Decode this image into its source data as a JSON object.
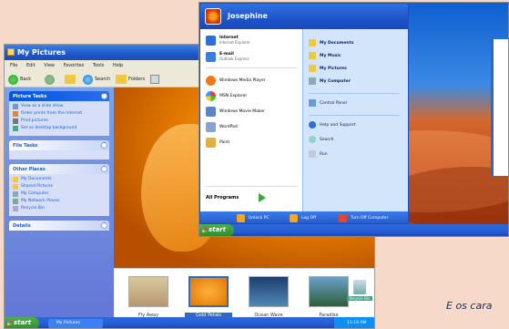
{
  "my_pictures": {
    "title": "My Pictures",
    "menu": [
      "File",
      "Edit",
      "View",
      "Favorites",
      "Tools",
      "Help"
    ],
    "toolbar": {
      "back": "Back",
      "search": "Search",
      "folders": "Folders"
    },
    "picture_tasks": {
      "title": "Picture Tasks",
      "items": [
        "View as a slide show",
        "Order prints from the Internet",
        "Print pictures",
        "Set as desktop background"
      ]
    },
    "file_tasks": {
      "title": "File Tasks"
    },
    "other_places": {
      "title": "Other Places",
      "items": [
        "My Documents",
        "Shared Pictures",
        "My Computer",
        "My Network Places",
        "Recycle Bin"
      ]
    },
    "details": {
      "title": "Details"
    },
    "thumbnails": [
      "Fly Away",
      "Gold Petals",
      "Ocean Wave",
      "Paradise"
    ],
    "selected_thumbnail": "Gold Petals",
    "recycle_bin": "Recycle Bin",
    "taskbar": {
      "start": "start",
      "task": "My Pictures",
      "clock": "11:19 AM"
    }
  },
  "start_menu": {
    "user": "Josephine",
    "left_items": [
      {
        "label": "Internet",
        "sub": "Internet Explorer",
        "color": "#2d6fd8"
      },
      {
        "label": "E-mail",
        "sub": "Outlook Express",
        "color": "#3b7ee0"
      },
      {
        "label": "Windows Media Player",
        "color": "#f07a1a"
      },
      {
        "label": "MSN Explorer",
        "color": "#3bb04a"
      },
      {
        "label": "Windows Movie Maker",
        "color": "#5a86c8"
      },
      {
        "label": "WordPad",
        "color": "#8aa2d0"
      },
      {
        "label": "Paint",
        "color": "#e0b040"
      }
    ],
    "all_programs": "All Programs",
    "right_items": [
      "My Documents",
      "My Music",
      "My Pictures",
      "My Computer",
      "Control Panel",
      "Help and Support",
      "Search",
      "Run"
    ],
    "footer": {
      "lock": "Unlock PC",
      "logoff": "Log Off",
      "turnoff": "Turn Off Computer"
    },
    "taskbar": {
      "start": "start"
    }
  },
  "caption": "E os cara"
}
